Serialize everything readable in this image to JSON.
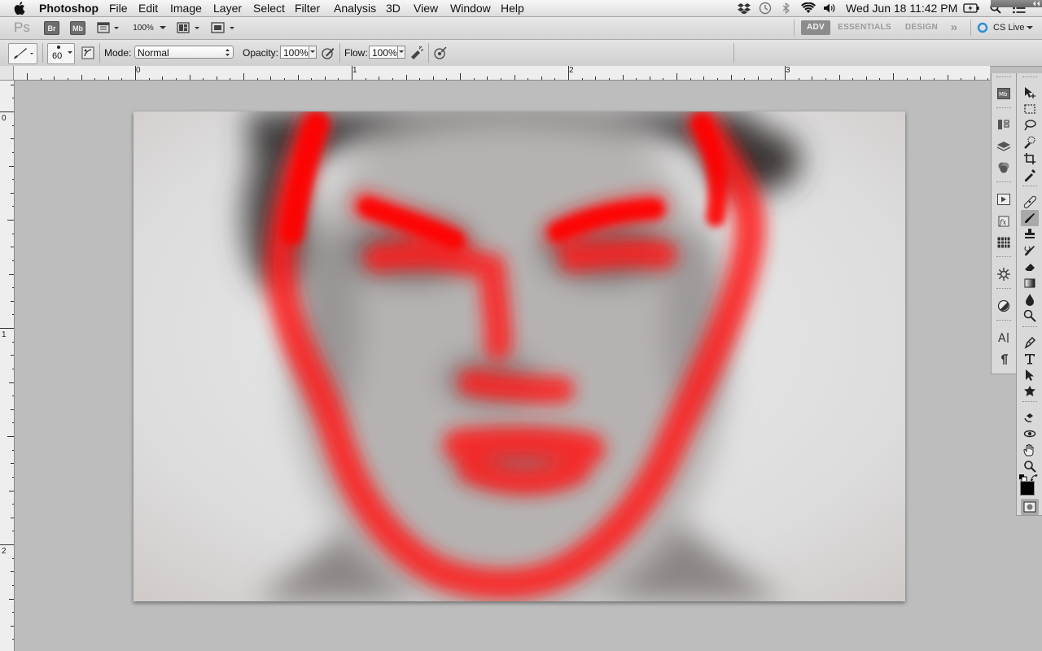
{
  "menubar": {
    "app_name": "Photoshop",
    "items": [
      "File",
      "Edit",
      "Image",
      "Layer",
      "Select",
      "Filter",
      "Analysis",
      "3D",
      "View",
      "Window",
      "Help"
    ],
    "clock": "Wed Jun 18  11:42 PM",
    "status_icons": [
      "dropbox-icon",
      "time-machine-icon",
      "bluetooth-icon",
      "wifi-icon",
      "volume-icon",
      "battery-icon",
      "spotlight-icon",
      "notification-list-icon"
    ]
  },
  "appbar": {
    "logo": "Ps",
    "bridge_label": "Br",
    "minibridge_label": "Mb",
    "zoom": "100%",
    "workspaces": [
      "ADV",
      "ESSENTIALS",
      "DESIGN"
    ],
    "active_workspace": "ADV",
    "more_glyph": "»",
    "cs_live": "CS Live"
  },
  "options": {
    "brush_size": "60",
    "mode_label": "Mode:",
    "mode_value": "Normal",
    "opacity_label": "Opacity:",
    "opacity_value": "100%",
    "flow_label": "Flow:",
    "flow_value": "100%"
  },
  "rulers": {
    "h_labels": [
      "0",
      "1",
      "2",
      "3"
    ],
    "v_labels": [
      "0",
      "1",
      "2"
    ]
  },
  "colors": {
    "paint": "#ff1a1a",
    "foreground": "#000000",
    "background": "#ffffff",
    "workspace_active_bg": "#8c8c8c"
  },
  "panels": {
    "dock_icons": [
      "mini-bridge-icon",
      "history-icon",
      "layers-icon",
      "channels-icon",
      "actions-icon",
      "styles-icon",
      "swatches-icon",
      "navigator-icon",
      "adjustments-icon",
      "character-icon",
      "paragraph-icon"
    ],
    "tool_icons": [
      "move-tool-icon",
      "marquee-tool-icon",
      "lasso-tool-icon",
      "quick-selection-tool-icon",
      "crop-tool-icon",
      "eyedropper-tool-icon",
      "healing-brush-tool-icon",
      "brush-tool-icon",
      "clone-stamp-tool-icon",
      "history-brush-tool-icon",
      "eraser-tool-icon",
      "gradient-tool-icon",
      "blur-tool-icon",
      "dodge-tool-icon",
      "pen-tool-icon",
      "type-tool-icon",
      "path-selection-tool-icon",
      "shape-tool-icon",
      "3d-rotate-tool-icon",
      "3d-orbit-tool-icon",
      "hand-tool-icon",
      "zoom-tool-icon"
    ]
  }
}
